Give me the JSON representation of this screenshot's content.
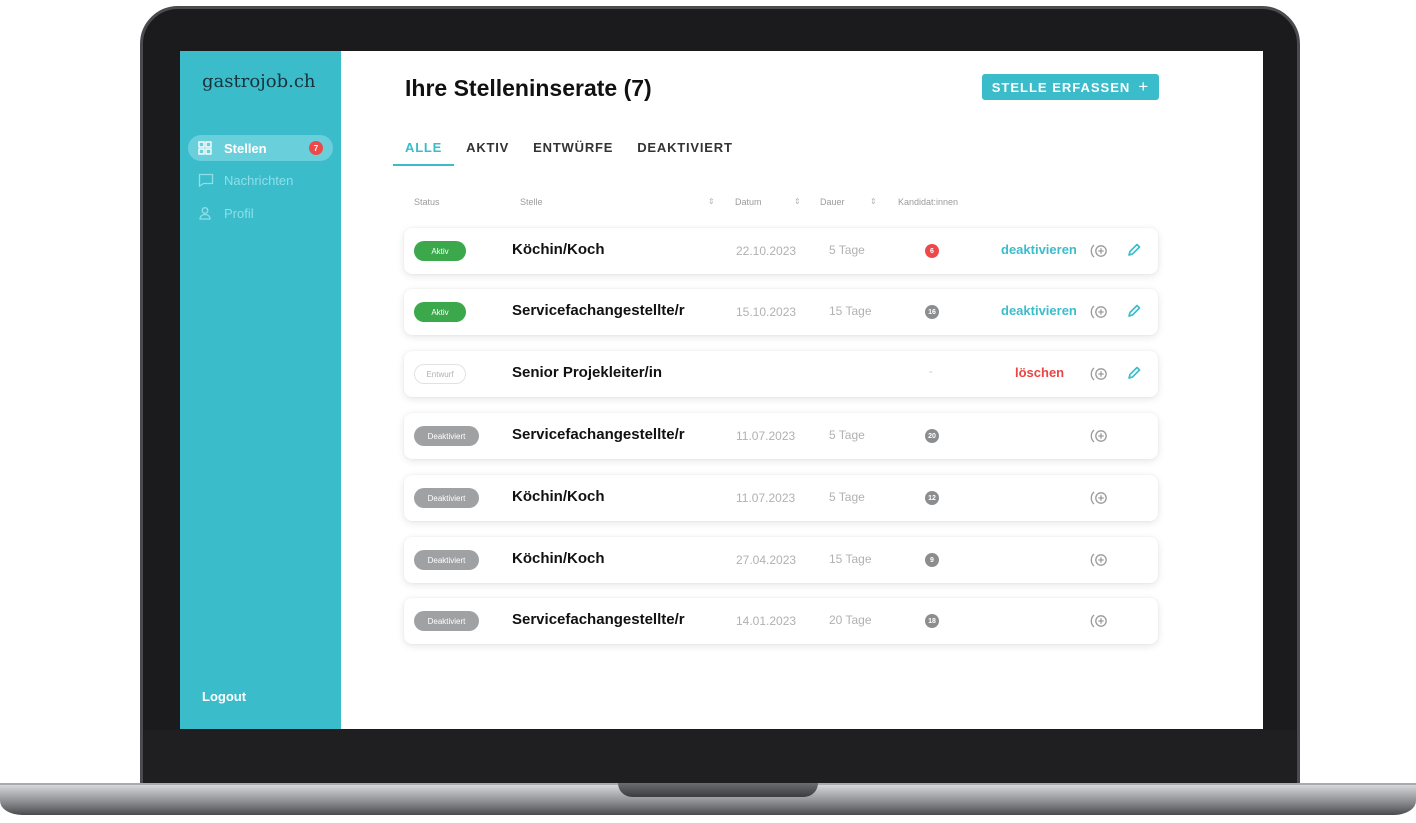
{
  "app": {
    "logo": "gastrojob.ch"
  },
  "sidebar": {
    "items": [
      {
        "label": "Stellen",
        "icon": "grid-icon",
        "badge": "7",
        "active": true
      },
      {
        "label": "Nachrichten",
        "icon": "chat-icon"
      },
      {
        "label": "Profil",
        "icon": "user-icon"
      }
    ],
    "logout": "Logout"
  },
  "header": {
    "title": "Ihre Stelleninserate (7)",
    "cta_label": "STELLE ERFASSEN",
    "cta_icon": "+"
  },
  "tabs": [
    "ALLE",
    "AKTIV",
    "ENTWÜRFE",
    "DEAKTIVIERT"
  ],
  "table": {
    "columns": [
      "Status",
      "Stelle",
      "Datum",
      "Dauer",
      "Kandidat:innen"
    ],
    "sort_glyph": "⇕",
    "rows": [
      {
        "status": "Aktiv",
        "stelle": "Köchin/Koch",
        "datum": "22.10.2023",
        "dauer": "5 Tage",
        "kandidaten": "6",
        "action": "deaktivieren"
      },
      {
        "status": "Aktiv",
        "stelle": "Servicefachangestellte/r",
        "datum": "15.10.2023",
        "dauer": "15 Tage",
        "kandidaten": "16",
        "action": "deaktivieren"
      },
      {
        "status": "Entwurf",
        "stelle": "Senior Projekleiter/in",
        "datum": "",
        "dauer": "",
        "kandidaten": "-",
        "action": "löschen"
      },
      {
        "status": "Deaktiviert",
        "stelle": "Servicefachangestellte/r",
        "datum": "11.07.2023",
        "dauer": "5 Tage",
        "kandidaten": "20",
        "action": ""
      },
      {
        "status": "Deaktiviert",
        "stelle": "Köchin/Koch",
        "datum": "11.07.2023",
        "dauer": "5 Tage",
        "kandidaten": "12",
        "action": ""
      },
      {
        "status": "Deaktiviert",
        "stelle": "Köchin/Koch",
        "datum": "27.04.2023",
        "dauer": "15 Tage",
        "kandidaten": "9",
        "action": ""
      },
      {
        "status": "Deaktiviert",
        "stelle": "Servicefachangestellte/r",
        "datum": "14.01.2023",
        "dauer": "20 Tage",
        "kandidaten": "18",
        "action": ""
      }
    ]
  },
  "colors": {
    "accent": "#3bbccb",
    "active": "#3aa84b",
    "danger": "#e84545",
    "inactive": "#a0a1a3"
  }
}
